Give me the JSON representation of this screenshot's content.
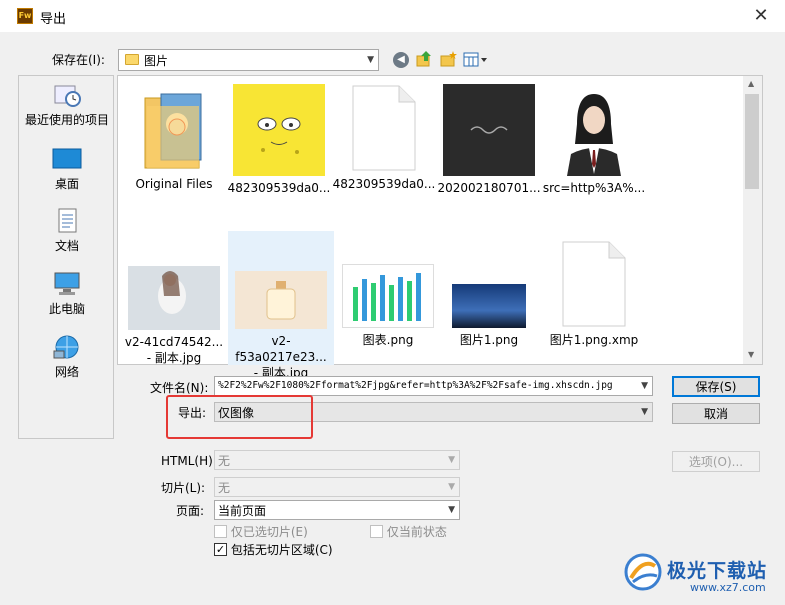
{
  "window": {
    "title": "导出",
    "app_icon_text": "Fw",
    "close_label": "✕"
  },
  "save_in": {
    "label": "保存在(I):",
    "value": "图片"
  },
  "places": [
    {
      "label": "最近使用的项目",
      "icon": "recent-icon"
    },
    {
      "label": "桌面",
      "icon": "desktop-icon"
    },
    {
      "label": "文档",
      "icon": "documents-icon"
    },
    {
      "label": "此电脑",
      "icon": "computer-icon"
    },
    {
      "label": "网络",
      "icon": "network-icon"
    }
  ],
  "files": [
    {
      "name": "Original Files",
      "type": "folder"
    },
    {
      "name": "482309539da0...",
      "type": "image"
    },
    {
      "name": "482309539da0...",
      "type": "blank"
    },
    {
      "name": "202002180701...",
      "type": "image"
    },
    {
      "name": "src=http%3A%...",
      "type": "image"
    },
    {
      "name": "v2-41cd74542...",
      "name2": "- 副本.jpg",
      "type": "image"
    },
    {
      "name": "v2-f53a0217e23...",
      "name2": "- 副本.jpg",
      "type": "image",
      "selected": true
    },
    {
      "name": "图表.png",
      "type": "image"
    },
    {
      "name": "图片1.png",
      "type": "image"
    },
    {
      "name": "图片1.png.xmp",
      "type": "blank"
    }
  ],
  "filename": {
    "label": "文件名(N):",
    "value": "%2F2%2Fw%2F1080%2Fformat%2Fjpg&refer=http%3A%2F%2Fsafe-img.xhscdn.jpg"
  },
  "export": {
    "label": "导出:",
    "value": "仅图像"
  },
  "html": {
    "label": "HTML(H):",
    "value": "无"
  },
  "slices": {
    "label": "切片(L):",
    "value": "无"
  },
  "page": {
    "label": "页面:",
    "value": "当前页面"
  },
  "checks": {
    "selected_slices": "仅已选切片(E)",
    "current_state": "仅当前状态",
    "include_areas": "包括无切片区域(C)"
  },
  "buttons": {
    "save": "保存(S)",
    "cancel": "取消",
    "options": "选项(O)..."
  },
  "watermark": {
    "text": "极光下载站",
    "url": "www.xz7.com"
  },
  "colors": {
    "accent": "#0078d7",
    "highlight": "#e53935"
  }
}
